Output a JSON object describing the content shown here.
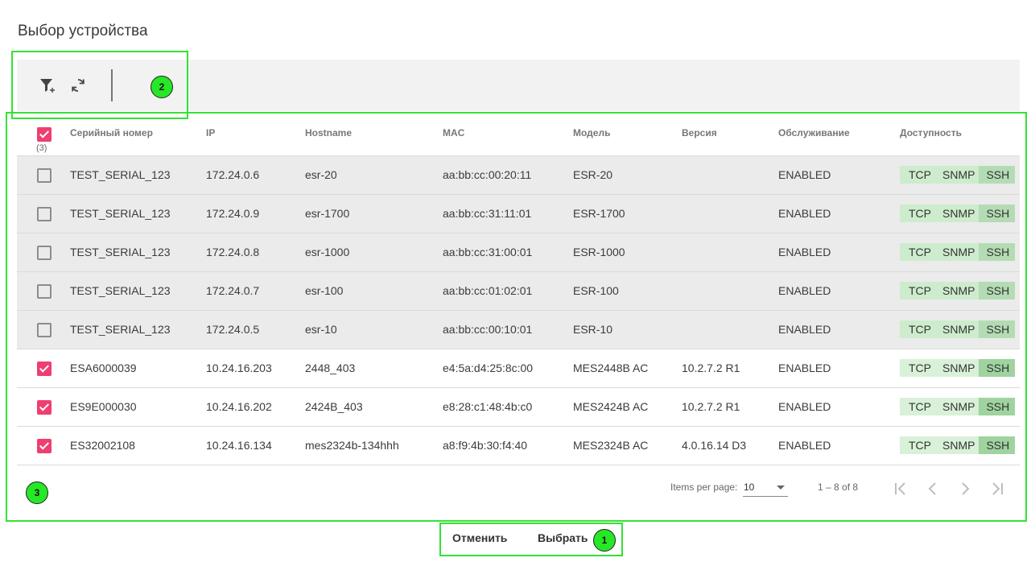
{
  "page": {
    "title": "Выбор устройства"
  },
  "toolbar": {
    "filter_icon": "filter-add-icon",
    "refresh_icon": "refresh-icon"
  },
  "annotations": {
    "badge1": "1",
    "badge2": "2",
    "badge3": "3"
  },
  "table": {
    "headers": {
      "serial": "Серийный номер",
      "ip": "IP",
      "hostname": "Hostname",
      "mac": "MAC",
      "model": "Модель",
      "version": "Версия",
      "service": "Обслуживание",
      "availability": "Доступность"
    },
    "selected_count": "(3)",
    "rows": [
      {
        "checked": false,
        "serial": "TEST_SERIAL_123",
        "ip": "172.24.0.6",
        "hostname": "esr-20",
        "mac": "aa:bb:cc:00:20:11",
        "model": "ESR-20",
        "version": "",
        "service": "ENABLED",
        "tcp": "TCP",
        "snmp": "SNMP",
        "ssh": "SSH"
      },
      {
        "checked": false,
        "serial": "TEST_SERIAL_123",
        "ip": "172.24.0.9",
        "hostname": "esr-1700",
        "mac": "aa:bb:cc:31:11:01",
        "model": "ESR-1700",
        "version": "",
        "service": "ENABLED",
        "tcp": "TCP",
        "snmp": "SNMP",
        "ssh": "SSH"
      },
      {
        "checked": false,
        "serial": "TEST_SERIAL_123",
        "ip": "172.24.0.8",
        "hostname": "esr-1000",
        "mac": "aa:bb:cc:31:00:01",
        "model": "ESR-1000",
        "version": "",
        "service": "ENABLED",
        "tcp": "TCP",
        "snmp": "SNMP",
        "ssh": "SSH"
      },
      {
        "checked": false,
        "serial": "TEST_SERIAL_123",
        "ip": "172.24.0.7",
        "hostname": "esr-100",
        "mac": "aa:bb:cc:01:02:01",
        "model": "ESR-100",
        "version": "",
        "service": "ENABLED",
        "tcp": "TCP",
        "snmp": "SNMP",
        "ssh": "SSH"
      },
      {
        "checked": false,
        "serial": "TEST_SERIAL_123",
        "ip": "172.24.0.5",
        "hostname": "esr-10",
        "mac": "aa:bb:cc:00:10:01",
        "model": "ESR-10",
        "version": "",
        "service": "ENABLED",
        "tcp": "TCP",
        "snmp": "SNMP",
        "ssh": "SSH"
      },
      {
        "checked": true,
        "serial": "ESA6000039",
        "ip": "10.24.16.203",
        "hostname": "2448_403",
        "mac": "e4:5a:d4:25:8c:00",
        "model": "MES2448B AC",
        "version": "10.2.7.2 R1",
        "service": "ENABLED",
        "tcp": "TCP",
        "snmp": "SNMP",
        "ssh": "SSH"
      },
      {
        "checked": true,
        "serial": "ES9E000030",
        "ip": "10.24.16.202",
        "hostname": "2424B_403",
        "mac": "e8:28:c1:48:4b:c0",
        "model": "MES2424B AC",
        "version": "10.2.7.2 R1",
        "service": "ENABLED",
        "tcp": "TCP",
        "snmp": "SNMP",
        "ssh": "SSH"
      },
      {
        "checked": true,
        "serial": "ES32002108",
        "ip": "10.24.16.134",
        "hostname": "mes2324b-134hhh",
        "mac": "a8:f9:4b:30:f4:40",
        "model": "MES2324B AC",
        "version": "4.0.16.14 D3",
        "service": "ENABLED",
        "tcp": "TCP",
        "snmp": "SNMP",
        "ssh": "SSH"
      }
    ]
  },
  "paginator": {
    "items_per_page_label": "Items per page:",
    "items_per_page_value": "10",
    "range_label": "1 – 8 of 8"
  },
  "dialog": {
    "cancel_label": "Отменить",
    "select_label": "Выбрать"
  },
  "colors": {
    "accent": "#ee3f70",
    "highlight": "#33e233",
    "availability_ok": "#cdeccd"
  }
}
